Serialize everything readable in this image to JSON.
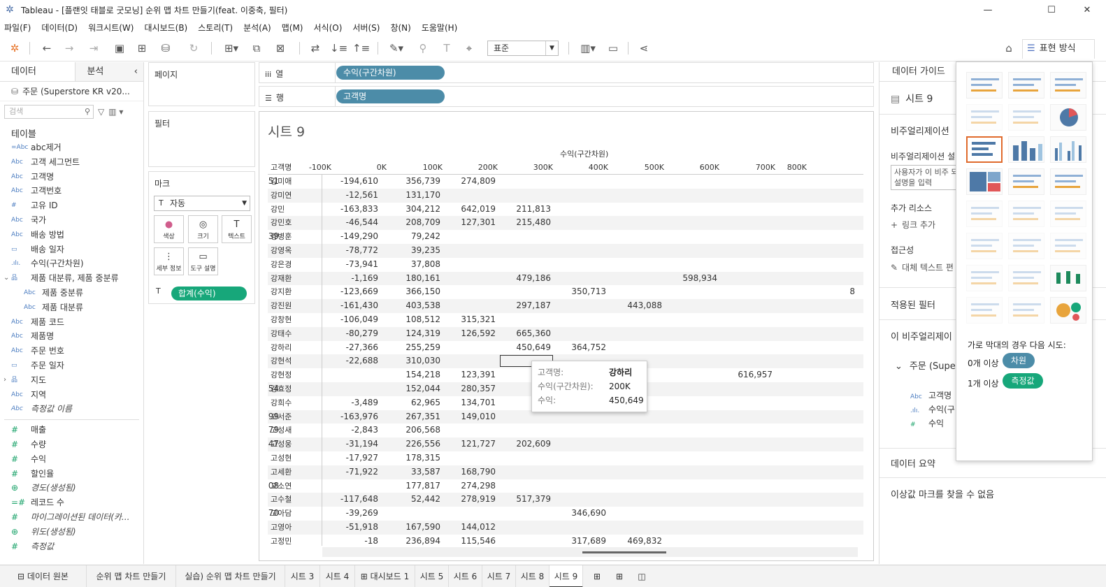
{
  "window": {
    "title": "Tableau - [플랜잇 태블로 굿모닝] 순위 맵 차트 만들기(feat. 이중축, 필터)"
  },
  "menu": [
    "파일(F)",
    "데이터(D)",
    "워크시트(W)",
    "대시보드(B)",
    "스토리(T)",
    "분석(A)",
    "맵(M)",
    "서식(O)",
    "서버(S)",
    "창(N)",
    "도움말(H)"
  ],
  "toolbar": {
    "fit_value": "표준",
    "show_me_label": "표현 방식"
  },
  "left_pane": {
    "tab_data": "데이터",
    "tab_analysis": "분석",
    "datasource": "주문 (Superstore KR v20...",
    "search_placeholder": "검색",
    "tables_title": "테이블",
    "dimensions": [
      {
        "icon": "=Abc",
        "label": "abc제거",
        "italic": false,
        "indent": false,
        "exp": ""
      },
      {
        "icon": "Abc",
        "label": "고객 세그먼트",
        "italic": false,
        "indent": false,
        "exp": ""
      },
      {
        "icon": "Abc",
        "label": "고객명",
        "italic": false,
        "indent": false,
        "exp": ""
      },
      {
        "icon": "Abc",
        "label": "고객번호",
        "italic": false,
        "indent": false,
        "exp": ""
      },
      {
        "icon": "#",
        "label": "고유 ID",
        "italic": false,
        "indent": false,
        "exp": ""
      },
      {
        "icon": "Abc",
        "label": "국가",
        "italic": false,
        "indent": false,
        "exp": ""
      },
      {
        "icon": "Abc",
        "label": "배송 방법",
        "italic": false,
        "indent": false,
        "exp": ""
      },
      {
        "icon": "▭",
        "label": "배송 일자",
        "italic": false,
        "indent": false,
        "exp": ""
      },
      {
        "icon": ".ılı.",
        "label": "수익(구간차원)",
        "italic": false,
        "indent": false,
        "exp": ""
      },
      {
        "icon": "品",
        "label": "제품 대분류, 제품 중분류",
        "italic": false,
        "indent": false,
        "exp": "⌄"
      },
      {
        "icon": "Abc",
        "label": "제품 중분류",
        "italic": false,
        "indent": true,
        "exp": ""
      },
      {
        "icon": "Abc",
        "label": "제품 대분류",
        "italic": false,
        "indent": true,
        "exp": ""
      },
      {
        "icon": "Abc",
        "label": "제품 코드",
        "italic": false,
        "indent": false,
        "exp": ""
      },
      {
        "icon": "Abc",
        "label": "제품명",
        "italic": false,
        "indent": false,
        "exp": ""
      },
      {
        "icon": "Abc",
        "label": "주문 번호",
        "italic": false,
        "indent": false,
        "exp": ""
      },
      {
        "icon": "▭",
        "label": "주문 일자",
        "italic": false,
        "indent": false,
        "exp": ""
      },
      {
        "icon": "品",
        "label": "지도",
        "italic": false,
        "indent": false,
        "exp": "›"
      },
      {
        "icon": "Abc",
        "label": "지역",
        "italic": false,
        "indent": false,
        "exp": ""
      },
      {
        "icon": "Abc",
        "label": "측정값 이름",
        "italic": true,
        "indent": false,
        "exp": ""
      }
    ],
    "measures": [
      {
        "icon": "#",
        "label": "매출",
        "italic": false
      },
      {
        "icon": "#",
        "label": "수량",
        "italic": false
      },
      {
        "icon": "#",
        "label": "수익",
        "italic": false
      },
      {
        "icon": "#",
        "label": "할인율",
        "italic": false
      },
      {
        "icon": "⊕",
        "label": "경도(생성됨)",
        "italic": true
      },
      {
        "icon": "=#",
        "label": "레코드 수",
        "italic": false
      },
      {
        "icon": "#",
        "label": "마이그레이션된 데이터(카...",
        "italic": true
      },
      {
        "icon": "⊕",
        "label": "위도(생성됨)",
        "italic": true
      },
      {
        "icon": "#",
        "label": "측정값",
        "italic": true
      }
    ]
  },
  "shelves": {
    "pages": "페이지",
    "filters": "필터",
    "marks": "마크",
    "mark_type": "자동",
    "mark_buttons": [
      "색상",
      "크기",
      "텍스트",
      "세부 정보",
      "도구 설명"
    ],
    "mark_pill": "합계(수익)",
    "columns_label": "열",
    "rows_label": "행",
    "columns_pill": "수익(구간차원)",
    "rows_pill": "고객명"
  },
  "view": {
    "sheet_title": "시트 9",
    "axis_title": "수익(구간차원)",
    "row_header": "고객명",
    "col_headers": [
      "0K",
      "-100K",
      "0K",
      "100K",
      "200K",
      "300K",
      "400K",
      "500K",
      "600K",
      "700K",
      "800K"
    ],
    "rows": [
      {
        "name": "강미애",
        "cells": [
          "51",
          "-194,610",
          "356,739",
          "274,809",
          "",
          "",
          "",
          "",
          "",
          "",
          ""
        ]
      },
      {
        "name": "강미연",
        "cells": [
          "",
          "-12,561",
          "131,170",
          "",
          "",
          "",
          "",
          "",
          "",
          "",
          ""
        ]
      },
      {
        "name": "강민",
        "cells": [
          "",
          "-163,833",
          "304,212",
          "642,019",
          "211,813",
          "",
          "",
          "",
          "",
          "",
          ""
        ]
      },
      {
        "name": "강민호",
        "cells": [
          "",
          "-46,544",
          "208,709",
          "127,301",
          "215,480",
          "",
          "",
          "",
          "",
          "",
          ""
        ]
      },
      {
        "name": "강병훈",
        "cells": [
          "39",
          "-149,290",
          "79,242",
          "",
          "",
          "",
          "",
          "",
          "",
          "",
          ""
        ]
      },
      {
        "name": "강영옥",
        "cells": [
          "",
          "-78,772",
          "39,235",
          "",
          "",
          "",
          "",
          "",
          "",
          "",
          ""
        ]
      },
      {
        "name": "강은경",
        "cells": [
          "",
          "-73,941",
          "37,808",
          "",
          "",
          "",
          "",
          "",
          "",
          "",
          ""
        ]
      },
      {
        "name": "강재환",
        "cells": [
          "",
          "-1,169",
          "180,161",
          "",
          "479,186",
          "",
          "",
          "598,934",
          "",
          "",
          ""
        ]
      },
      {
        "name": "강지환",
        "cells": [
          "",
          "-123,669",
          "366,150",
          "",
          "",
          "350,713",
          "",
          "",
          "",
          "",
          "8"
        ]
      },
      {
        "name": "강진원",
        "cells": [
          "",
          "-161,430",
          "403,538",
          "",
          "297,187",
          "",
          "443,088",
          "",
          "",
          "",
          ""
        ]
      },
      {
        "name": "강창현",
        "cells": [
          "",
          "-106,049",
          "108,512",
          "315,321",
          "",
          "",
          "",
          "",
          "",
          "",
          ""
        ]
      },
      {
        "name": "강태수",
        "cells": [
          "",
          "-80,279",
          "124,319",
          "126,592",
          "665,360",
          "",
          "",
          "",
          "",
          "",
          ""
        ]
      },
      {
        "name": "강하리",
        "cells": [
          "",
          "-27,366",
          "255,259",
          "",
          "450,649",
          "364,752",
          "",
          "",
          "",
          "",
          ""
        ]
      },
      {
        "name": "강현석",
        "cells": [
          "",
          "-22,688",
          "310,030",
          "",
          "",
          "",
          "",
          "",
          "",
          "",
          ""
        ]
      },
      {
        "name": "강현정",
        "cells": [
          "",
          "",
          "154,218",
          "123,391",
          "",
          "",
          "",
          "",
          "616,957",
          "",
          ""
        ]
      },
      {
        "name": "강효정",
        "cells": [
          "54",
          "",
          "152,044",
          "280,357",
          "",
          "",
          "",
          "",
          "",
          "",
          ""
        ]
      },
      {
        "name": "강희수",
        "cells": [
          "",
          "-3,489",
          "62,965",
          "134,701",
          "489",
          "",
          "",
          "",
          "",
          "",
          ""
        ]
      },
      {
        "name": "고서준",
        "cells": [
          "99",
          "-163,976",
          "267,351",
          "149,010",
          "",
          "",
          "",
          "",
          "",
          "",
          ""
        ]
      },
      {
        "name": "고성새",
        "cells": [
          "79",
          "-2,843",
          "206,568",
          "",
          "",
          "",
          "",
          "",
          "",
          "",
          ""
        ]
      },
      {
        "name": "고성웅",
        "cells": [
          "47",
          "-31,194",
          "226,556",
          "121,727",
          "202,609",
          "",
          "",
          "",
          "",
          "",
          ""
        ]
      },
      {
        "name": "고성현",
        "cells": [
          "",
          "-17,927",
          "178,315",
          "",
          "",
          "",
          "",
          "",
          "",
          "",
          ""
        ]
      },
      {
        "name": "고세환",
        "cells": [
          "",
          "-71,922",
          "33,587",
          "168,790",
          "",
          "",
          "",
          "",
          "",
          "",
          ""
        ]
      },
      {
        "name": "고소연",
        "cells": [
          "08",
          "",
          "177,817",
          "274,298",
          "",
          "",
          "",
          "",
          "",
          "",
          ""
        ]
      },
      {
        "name": "고수철",
        "cells": [
          "",
          "-117,648",
          "52,442",
          "278,919",
          "517,379",
          "",
          "",
          "",
          "",
          "",
          ""
        ]
      },
      {
        "name": "고아담",
        "cells": [
          "70",
          "-39,269",
          "",
          "",
          "",
          "346,690",
          "",
          "",
          "",
          "",
          ""
        ]
      },
      {
        "name": "고영아",
        "cells": [
          "",
          "-51,918",
          "167,590",
          "144,012",
          "",
          "",
          "",
          "",
          "",
          "",
          ""
        ]
      },
      {
        "name": "고정민",
        "cells": [
          "",
          "-18",
          "236,894",
          "115,546",
          "",
          "317,689",
          "469,832",
          "",
          "",
          "",
          ""
        ]
      }
    ],
    "tooltip": {
      "k1": "고객명:",
      "v1": "강하리",
      "k2": "수익(구간차원):",
      "v2": "200K",
      "k3": "수익:",
      "v3": "450,649"
    }
  },
  "guide": {
    "title": "데이터 가이드",
    "sheet": "시트 9",
    "viz_desc_title": "비주얼리제이션",
    "viz_desc_label": "비주얼리제이션 설",
    "viz_desc_box": "사용자가 이 비주 되는 설명을 입력",
    "resources_title": "추가 리소스",
    "add_link": "링크 추가",
    "accessibility": "접근성",
    "alt_text": "대체 텍스트 편",
    "filters_title": "적용된 필터",
    "this_viz": "이 비주얼리제이",
    "datasource_item": "주문 (Supe",
    "fields": [
      {
        "icon": "Abc",
        "label": "고객명"
      },
      {
        "icon": ".ılı.",
        "label": "수익(구"
      },
      {
        "icon": "#",
        "label": "수익"
      }
    ],
    "summary": "데이터 요약",
    "outliers": "이상값 마크를 찾을 수 없음"
  },
  "show_me": {
    "hint": "가로 막대의 경우 다음 시도:",
    "dim_req": "0개 이상",
    "dim_pill": "차원",
    "meas_req": "1개 이상",
    "meas_pill": "측정값"
  },
  "tabs": [
    "데이터 원본",
    "순위 맵 차트 만들기",
    "실습) 순위 맵 차트 만들기",
    "시트 3",
    "시트 4",
    "대시보드 1",
    "시트 5",
    "시트 6",
    "시트 7",
    "시트 8",
    "시트 9"
  ],
  "colors": {
    "pill_blue": "#4c8ca8",
    "pill_green": "#17a77a",
    "selected": "#e06a2c"
  }
}
